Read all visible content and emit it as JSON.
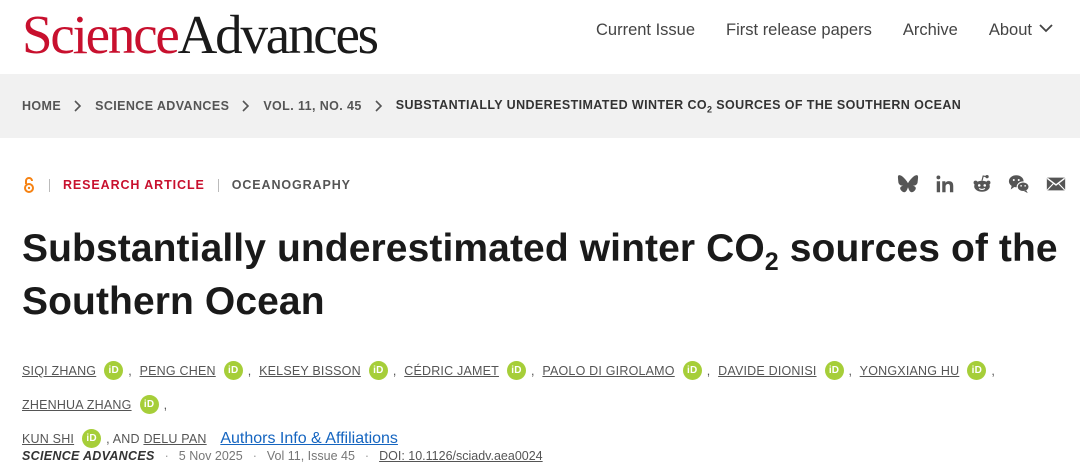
{
  "header": {
    "logo_science": "Science",
    "logo_advances": "Advances",
    "nav": [
      {
        "label": "Current Issue"
      },
      {
        "label": "First release papers"
      },
      {
        "label": "Archive"
      },
      {
        "label": "About",
        "icon": "chevron-down-icon"
      }
    ]
  },
  "breadcrumb": {
    "items": [
      "HOME",
      "SCIENCE ADVANCES",
      "VOL. 11, NO. 45"
    ],
    "current_pre": "SUBSTANTIALLY UNDERESTIMATED WINTER CO",
    "current_sub": "2",
    "current_post": " SOURCES OF THE SOUTHERN OCEAN"
  },
  "meta": {
    "open_access_icon": "open-access-icon",
    "article_type": "RESEARCH ARTICLE",
    "subject": "OCEANOGRAPHY"
  },
  "share": [
    "bluesky-icon",
    "linkedin-icon",
    "reddit-icon",
    "wechat-icon",
    "email-icon"
  ],
  "title": {
    "pre": "Substantially underestimated winter CO",
    "sub": "2",
    "post": " sources of the Southern Ocean"
  },
  "authors": [
    {
      "name": "SIQI ZHANG",
      "orcid": "iD"
    },
    {
      "name": "PENG CHEN",
      "orcid": "iD"
    },
    {
      "name": "KELSEY BISSON",
      "orcid": "iD"
    },
    {
      "name": "CÉDRIC JAMET",
      "orcid": "iD"
    },
    {
      "name": "PAOLO DI GIROLAMO",
      "orcid": "iD"
    },
    {
      "name": "DAVIDE DIONISI",
      "orcid": "iD"
    },
    {
      "name": "YONGXIANG HU",
      "orcid": "iD"
    },
    {
      "name": "ZHENHUA ZHANG",
      "orcid": "iD"
    },
    {
      "name": "KUN SHI",
      "orcid": "iD"
    },
    {
      "name": "DELU PAN"
    }
  ],
  "authors_and": ", AND ",
  "affiliations_link": "Authors Info & Affiliations",
  "citation": {
    "journal": "SCIENCE ADVANCES",
    "date": "5 Nov 2025",
    "volume": "Vol 11, Issue 45",
    "doi": "DOI: 10.1126/sciadv.aea0024"
  },
  "colors": {
    "brand_red": "#c8102e",
    "orcid_green": "#a6ce39",
    "link_blue": "#1565c0"
  }
}
